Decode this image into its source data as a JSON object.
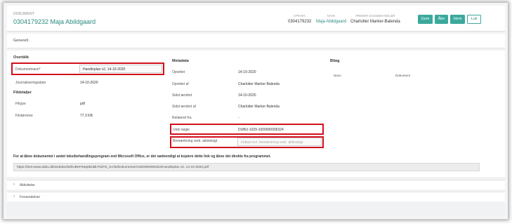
{
  "header": {
    "doc_type": "DOKUMENT",
    "title": "0304179232 Maja Abildgaard",
    "cpr_label": "CPR-NR.",
    "cpr_value": "0304179232",
    "navn_label": "NAVN",
    "navn_value": "Maja Abildgaard",
    "sagsbeh_label": "PRIMÆR SAGSBEHANDLER",
    "sagsbeh_value": "Charlotter Marker-Balenda",
    "buttons": {
      "gem": "Gem",
      "aabn": "Åbn",
      "hent": "Hent",
      "luk": "Luk"
    }
  },
  "tab": {
    "label": "Generelt"
  },
  "overblik": {
    "heading": "Overblik",
    "dokumentnavn_label": "Dokumentnavn*",
    "dokumentnavn_value": "Handleplan v2, 14-10-2020",
    "journal_label": "Journaliseringsdato",
    "journal_value": "14-10-2020"
  },
  "fildetaljer": {
    "heading": "Fildetaljer",
    "filtype_label": "Filtype",
    "filtype_value": "pdf",
    "filstr_label": "Filstørrelse",
    "filstr_value": "77.3 KB"
  },
  "metadata": {
    "heading": "Metadata",
    "oprettet_label": "Oprettet",
    "oprettet_value": "14-10-2020",
    "oprettet_af_label": "Oprettet af",
    "oprettet_af_value": "Charlotter Marker-Balenda",
    "sidst_label": "Sidst ændret",
    "sidst_value": "14-10-2020",
    "sidst_af_label": "Sidst ændret af",
    "sidst_af_value": "Charlotter Marker-Balenda",
    "relateret_label": "Relateret fra",
    "relateret_value": "-",
    "unik_label": "Unik nøgle",
    "unik_value": "DUBU-1029-1000000006324",
    "bemaerk_label": "Bemærkning vedr. aktindsigt",
    "bemaerk_placeholder": "Indtast evt. bemærkning vedr. aktindsigt"
  },
  "bilag": {
    "heading": "Bilag",
    "col_navn": "Navn",
    "col_dokument": "Dokument"
  },
  "note": "For at åbne dokumentet i andet tekstbehandlingsprogram end Microsoft Office, er det nødvendigt at kopiere dette link og åbne det direkte fra programmet.",
  "url": "https://test-www.dubu.dk/webdav/ts/bUBeFK6q08zdB-RidY6_XA/ts/Dokumenter/1000000006324/Handleplan v2, 14-10-2020.pdf",
  "accordions": {
    "aktiviteter": "Aktiviteter",
    "forsendelser": "Forsendelser"
  },
  "colors": {
    "accent": "#3aa99c",
    "highlight": "#d2101c"
  }
}
